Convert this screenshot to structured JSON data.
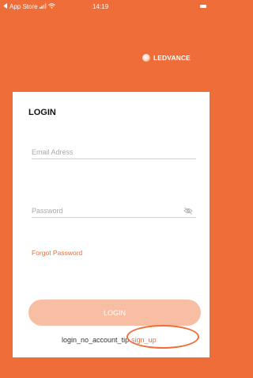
{
  "status_bar": {
    "carrier": "App Store",
    "time": "14:19"
  },
  "brand": {
    "name": "LEDVANCE"
  },
  "login": {
    "title": "LOGIN",
    "email_placeholder": "Email Adress",
    "password_placeholder": "Password",
    "forgot_password": "Forgot Password",
    "login_button": "LOGIN",
    "no_account_tip": "login_no_account_tip",
    "sign_up": "sign_up"
  },
  "icons": {
    "back": "back-arrow-icon",
    "signal": "signal-icon",
    "wifi": "wifi-icon",
    "battery": "battery-icon",
    "eye_hidden": "eye-off-icon"
  },
  "colors": {
    "brand_orange": "#ee6d38",
    "button_disabled": "#f7bea4"
  }
}
